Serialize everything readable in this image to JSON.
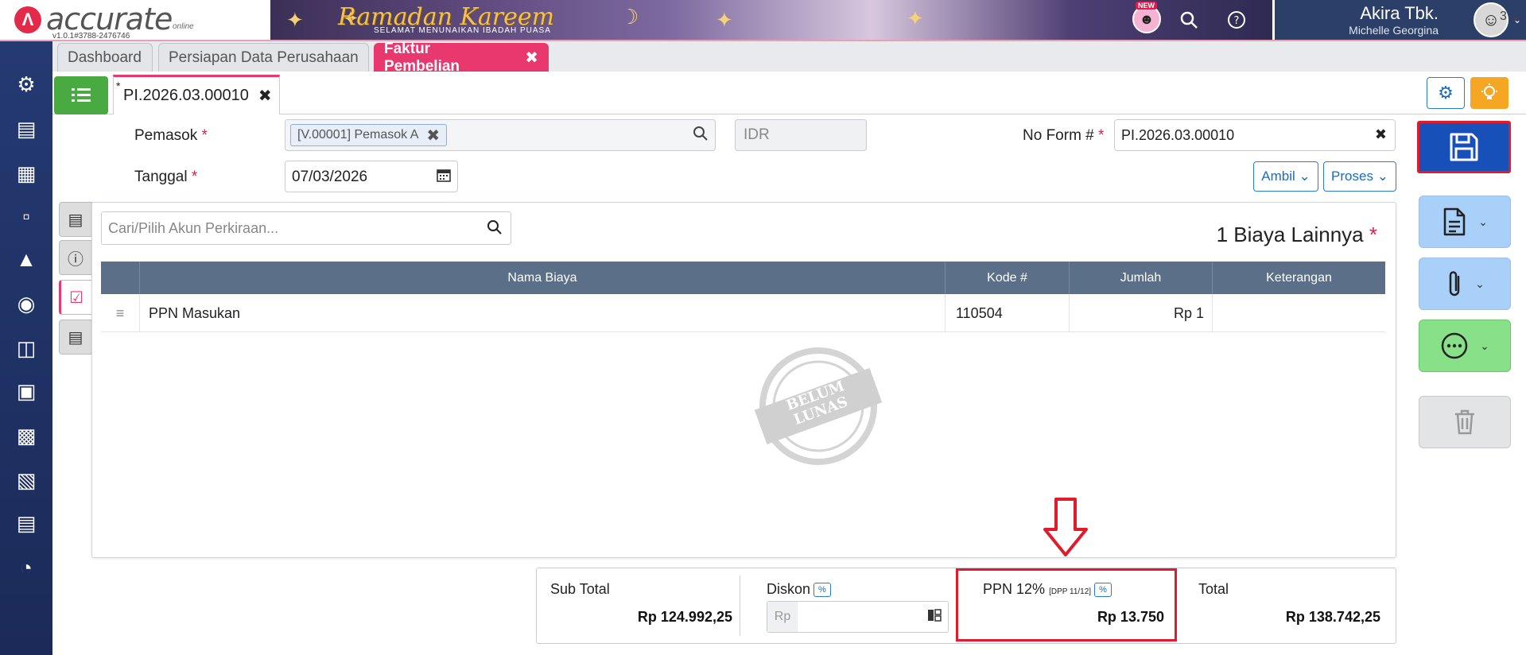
{
  "app": {
    "logo_text": "accurate",
    "logo_sub": "online",
    "version": "v1.0.1#3788-2476746"
  },
  "banner": {
    "title": "Ramadan Kareem",
    "subtitle": "SELAMAT MENUNAIKAN IBADAH PUASA"
  },
  "header": {
    "new_badge": "NEW",
    "company": "Akira Tbk.",
    "user": "Michelle Georgina"
  },
  "module_tabs": [
    {
      "label": "Dashboard"
    },
    {
      "label": "Persiapan Data Perusahaan"
    },
    {
      "label": "Faktur Pembelian"
    }
  ],
  "tab_count": "3",
  "document_tab": {
    "modified_marker": "*",
    "label": "PI.2026.03.00010"
  },
  "form": {
    "supplier_label": "Pemasok",
    "supplier_value": "[V.00001] Pemasok A",
    "currency_placeholder": "IDR",
    "noform_label": "No Form #",
    "noform_value": "PI.2026.03.00010",
    "date_label": "Tanggal",
    "date_value": "07/03/2026",
    "required_mark": "*",
    "ambil_label": "Ambil",
    "proses_label": "Proses"
  },
  "panel": {
    "search_placeholder": "Cari/Pilih Akun Perkiraan...",
    "count_title": "1 Biaya Lainnya",
    "columns": {
      "nama": "Nama Biaya",
      "kode": "Kode #",
      "jumlah": "Jumlah",
      "keterangan": "Keterangan"
    },
    "rows": [
      {
        "nama": "PPN Masukan",
        "kode": "110504",
        "jumlah": "Rp 1",
        "keterangan": ""
      }
    ],
    "stamp_line1": "BELUM",
    "stamp_line2": "LUNAS"
  },
  "totals": {
    "subtotal_label": "Sub Total",
    "subtotal_value": "Rp 124.992,25",
    "diskon_label": "Diskon",
    "pct": "%",
    "diskon_prefix": "Rp",
    "ppn_label": "PPN 12%",
    "ppn_note": "[DPP 11/12]",
    "ppn_value": "Rp 13.750",
    "total_label": "Total",
    "total_value": "Rp 138.742,25"
  },
  "colors": {
    "accent_pink": "#e8386d",
    "save_blue": "#1650b8",
    "highlight_red": "#e01b2b",
    "green": "#4aaa42"
  }
}
